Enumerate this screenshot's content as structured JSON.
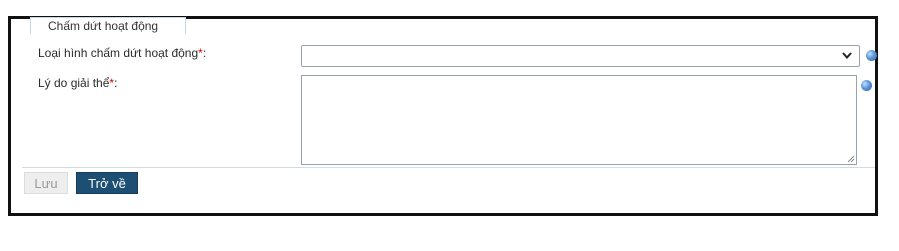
{
  "section": {
    "title": "Chấm dứt hoạt động"
  },
  "fields": {
    "termination_type": {
      "label": "Loại hình chấm dứt hoạt động",
      "required_mark": "*",
      "suffix": ":",
      "value": ""
    },
    "dissolution_reason": {
      "label": "Lý do giải thể",
      "required_mark": "*",
      "suffix": ":",
      "value": ""
    }
  },
  "buttons": {
    "save_label": "Lưu",
    "back_label": "Trở về"
  },
  "icons": {
    "help": "info-icon",
    "dropdown": "chevron-down-icon"
  },
  "colors": {
    "required": "#dd0000",
    "primary_button": "#1d4e74",
    "disabled_button": "#eeeeee"
  }
}
